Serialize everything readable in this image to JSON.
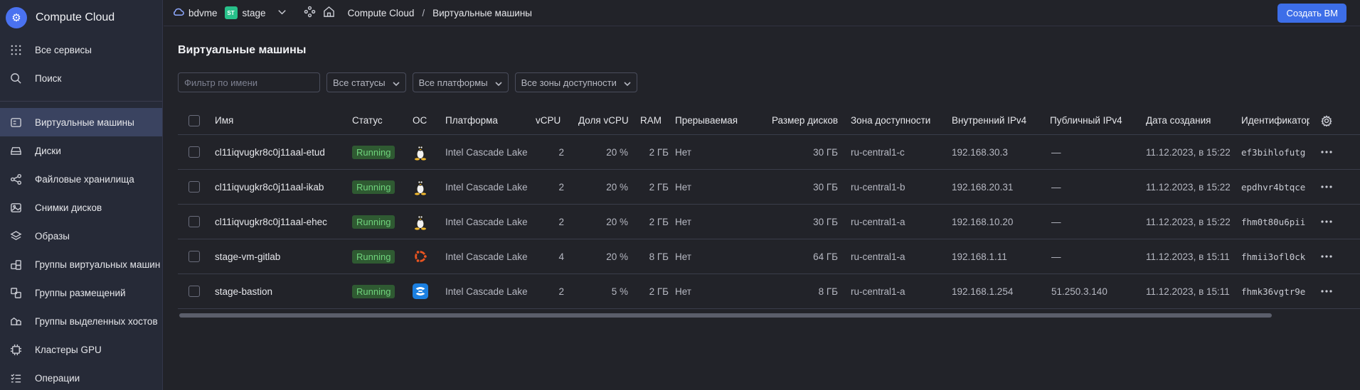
{
  "app": {
    "title": "Compute Cloud"
  },
  "sidebar": {
    "top_items": [
      {
        "label": "Все сервисы",
        "icon": "grid-icon"
      },
      {
        "label": "Поиск",
        "icon": "search-icon"
      }
    ],
    "items": [
      {
        "label": "Виртуальные машины",
        "icon": "vm-icon",
        "active": true
      },
      {
        "label": "Диски",
        "icon": "disk-icon"
      },
      {
        "label": "Файловые хранилища",
        "icon": "share-icon"
      },
      {
        "label": "Снимки дисков",
        "icon": "image-icon"
      },
      {
        "label": "Образы",
        "icon": "layers-icon"
      },
      {
        "label": "Группы виртуальных машин",
        "icon": "cubes-icon"
      },
      {
        "label": "Группы размещений",
        "icon": "placement-icon"
      },
      {
        "label": "Группы выделенных хостов",
        "icon": "hosts-icon"
      },
      {
        "label": "Кластеры GPU",
        "icon": "gpu-icon"
      },
      {
        "label": "Операции",
        "icon": "list-icon"
      }
    ]
  },
  "topbar": {
    "cloud": "bdvme",
    "folder_badge": "ST",
    "folder": "stage",
    "breadcrumb_service": "Compute Cloud",
    "breadcrumb_sep": "/",
    "breadcrumb_page": "Виртуальные машины",
    "create_button": "Создать ВМ"
  },
  "page": {
    "title": "Виртуальные машины",
    "filters": {
      "name_placeholder": "Фильтр по имени",
      "status": "Все статусы",
      "platform": "Все платформы",
      "zone": "Все зоны доступности"
    }
  },
  "table": {
    "columns": {
      "name": "Имя",
      "status": "Статус",
      "os": "ОС",
      "platform": "Платформа",
      "vcpu": "vCPU",
      "vcpu_share": "Доля vCPU",
      "ram": "RAM",
      "preemptible": "Прерываемая",
      "disk_size": "Размер дисков",
      "zone": "Зона доступности",
      "ipv4_internal": "Внутренний IPv4",
      "ipv4_public": "Публичный IPv4",
      "created": "Дата создания",
      "id": "Идентификатор"
    },
    "rows": [
      {
        "name": "cl11iqvugkr8c0j11aal-etud",
        "status": "Running",
        "os": "linux-icon",
        "platform": "Intel Cascade Lake",
        "vcpu": "2",
        "vcpu_share": "20 %",
        "ram": "2 ГБ",
        "preemptible": "Нет",
        "disk_size": "30 ГБ",
        "zone": "ru-central1-c",
        "ipv4_internal": "192.168.30.3",
        "ipv4_public": "—",
        "created": "11.12.2023, в 15:22",
        "id": "ef3bihlofutg"
      },
      {
        "name": "cl11iqvugkr8c0j11aal-ikab",
        "status": "Running",
        "os": "linux-icon",
        "platform": "Intel Cascade Lake",
        "vcpu": "2",
        "vcpu_share": "20 %",
        "ram": "2 ГБ",
        "preemptible": "Нет",
        "disk_size": "30 ГБ",
        "zone": "ru-central1-b",
        "ipv4_internal": "192.168.20.31",
        "ipv4_public": "—",
        "created": "11.12.2023, в 15:22",
        "id": "epdhvr4btqce"
      },
      {
        "name": "cl11iqvugkr8c0j11aal-ehec",
        "status": "Running",
        "os": "linux-icon",
        "platform": "Intel Cascade Lake",
        "vcpu": "2",
        "vcpu_share": "20 %",
        "ram": "2 ГБ",
        "preemptible": "Нет",
        "disk_size": "30 ГБ",
        "zone": "ru-central1-a",
        "ipv4_internal": "192.168.10.20",
        "ipv4_public": "—",
        "created": "11.12.2023, в 15:22",
        "id": "fhm0t80u6pii"
      },
      {
        "name": "stage-vm-gitlab",
        "status": "Running",
        "os": "ubuntu-icon",
        "platform": "Intel Cascade Lake",
        "vcpu": "4",
        "vcpu_share": "20 %",
        "ram": "8 ГБ",
        "preemptible": "Нет",
        "disk_size": "64 ГБ",
        "zone": "ru-central1-a",
        "ipv4_internal": "192.168.1.11",
        "ipv4_public": "—",
        "created": "11.12.2023, в 15:11",
        "id": "fhmii3ofl0ck"
      },
      {
        "name": "stage-bastion",
        "status": "Running",
        "os": "other-os-icon",
        "platform": "Intel Cascade Lake",
        "vcpu": "2",
        "vcpu_share": "5 %",
        "ram": "2 ГБ",
        "preemptible": "Нет",
        "disk_size": "8 ГБ",
        "zone": "ru-central1-a",
        "ipv4_internal": "192.168.1.254",
        "ipv4_public": "51.250.3.140",
        "created": "11.12.2023, в 15:11",
        "id": "fhmk36vgtr9e"
      }
    ]
  },
  "colors": {
    "accent": "#3d6ee8",
    "status_running_bg": "#2f5a32",
    "status_running_text": "#6fd37c",
    "sidebar_bg": "#262a37",
    "page_bg": "#222329"
  }
}
